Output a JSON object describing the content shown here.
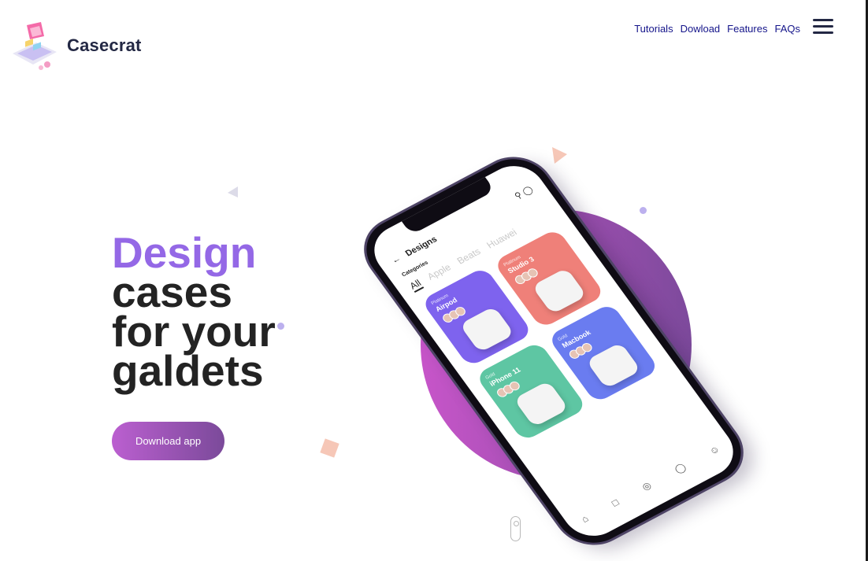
{
  "brand": {
    "name": "Casecrat",
    "logo_icon": "isometric-device-logo"
  },
  "nav": {
    "items": [
      "Tutorials",
      "Dowload",
      "Features",
      "FAQs"
    ],
    "menu_icon": "hamburger-menu-icon"
  },
  "hero": {
    "line1": "Design",
    "line2": "cases",
    "line3": "for your",
    "line4": "galdets",
    "cta_label": "Download app"
  },
  "phone_screen": {
    "title": "Designs",
    "back_glyph": "←",
    "categories_label": "Categories",
    "tabs": [
      "All",
      "Apple",
      "Beats",
      "Huawei"
    ],
    "cards": [
      {
        "sub": "Platinum",
        "name": "Airpod",
        "color": "#7e63ee"
      },
      {
        "sub": "Platinum",
        "name": "Studio 3",
        "color": "#ef8079"
      },
      {
        "sub": "Gold",
        "name": "iPhone 11",
        "color": "#5ec6a3"
      },
      {
        "sub": "Gold",
        "name": "Macbook",
        "color": "#6a7cf0"
      }
    ],
    "bottom_nav_icons": [
      "home-icon",
      "bookmark-icon",
      "compass-icon",
      "bag-icon",
      "profile-icon"
    ]
  },
  "colors": {
    "accent_purple": "#9468e6",
    "button_gradient_start": "#bb5fd0",
    "button_gradient_end": "#7b4a9a",
    "circle_start": "#c755c9",
    "circle_end": "#7d4a9c",
    "text_dark": "#232323",
    "nav_link": "#14148a"
  }
}
